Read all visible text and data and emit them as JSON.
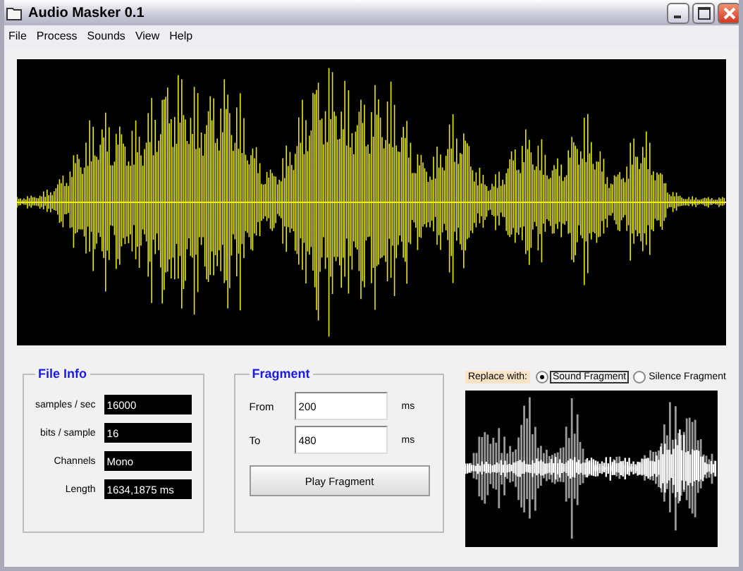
{
  "window": {
    "title": "Audio Masker 0.1"
  },
  "menu": [
    "File",
    "Process",
    "Sounds",
    "View",
    "Help"
  ],
  "file_info": {
    "title": "File Info",
    "fields": [
      {
        "label": "samples / sec",
        "value": "16000"
      },
      {
        "label": "bits / sample",
        "value": "16"
      },
      {
        "label": "Channels",
        "value": "Mono"
      },
      {
        "label": "Length",
        "value": "1634,1875 ms"
      }
    ]
  },
  "fragment": {
    "title": "Fragment",
    "fields": [
      {
        "label": "From",
        "value": "200",
        "unit": "ms"
      },
      {
        "label": "To",
        "value": "480",
        "unit": "ms"
      }
    ],
    "button": "Play Fragment"
  },
  "replace": {
    "label": "Replace with:",
    "options": [
      {
        "label": "Sound Fragment",
        "selected": true
      },
      {
        "label": "Silence Fragment",
        "selected": false
      }
    ]
  }
}
